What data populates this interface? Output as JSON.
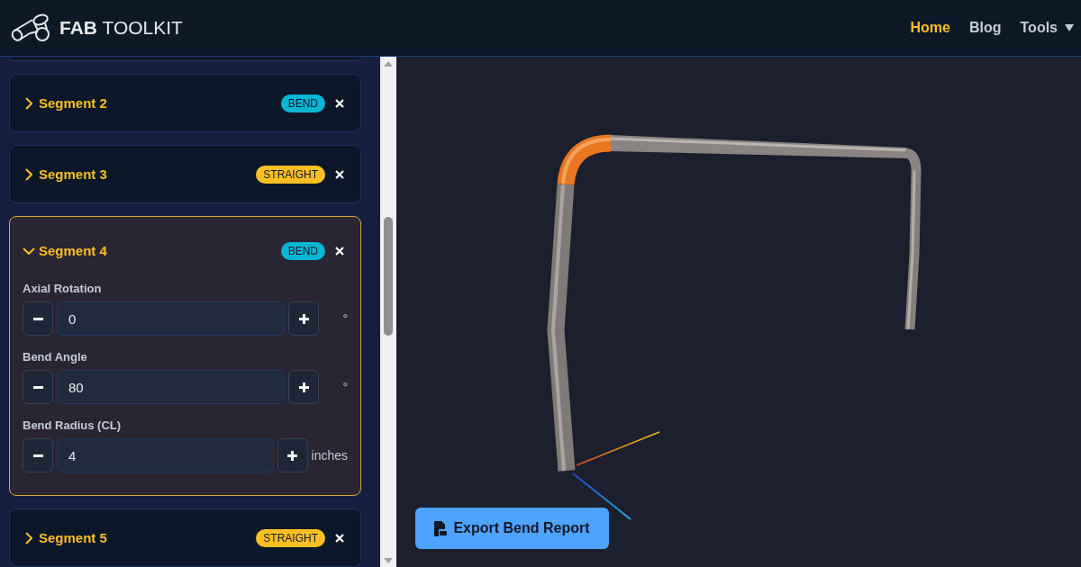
{
  "header": {
    "logo_text": "**FAB** TOOLKIT",
    "nav": [
      {
        "label": "Home",
        "selected": true,
        "dropdown": false
      },
      {
        "label": "Blog",
        "selected": false,
        "dropdown": false
      },
      {
        "label": "Tools",
        "selected": false,
        "dropdown": true
      }
    ]
  },
  "segments": [
    {
      "title": "Segment 2",
      "kind": "bend",
      "badge": "BEND",
      "expanded": false
    },
    {
      "title": "Segment 3",
      "kind": "straight",
      "badge": "STRAIGHT",
      "expanded": false
    },
    {
      "title": "Segment 4",
      "kind": "bend",
      "badge": "BEND",
      "expanded": true,
      "fields": [
        {
          "label": "Axial Rotation",
          "value": "0",
          "unit": "°"
        },
        {
          "label": "Bend Angle",
          "value": "80",
          "unit": "°"
        },
        {
          "label": "Bend Radius (CL)",
          "value": "4",
          "unit": "inches"
        }
      ]
    },
    {
      "title": "Segment 5",
      "kind": "straight",
      "badge": "STRAIGHT",
      "expanded": false
    }
  ],
  "export_button": {
    "label": "Export Bend Report"
  }
}
